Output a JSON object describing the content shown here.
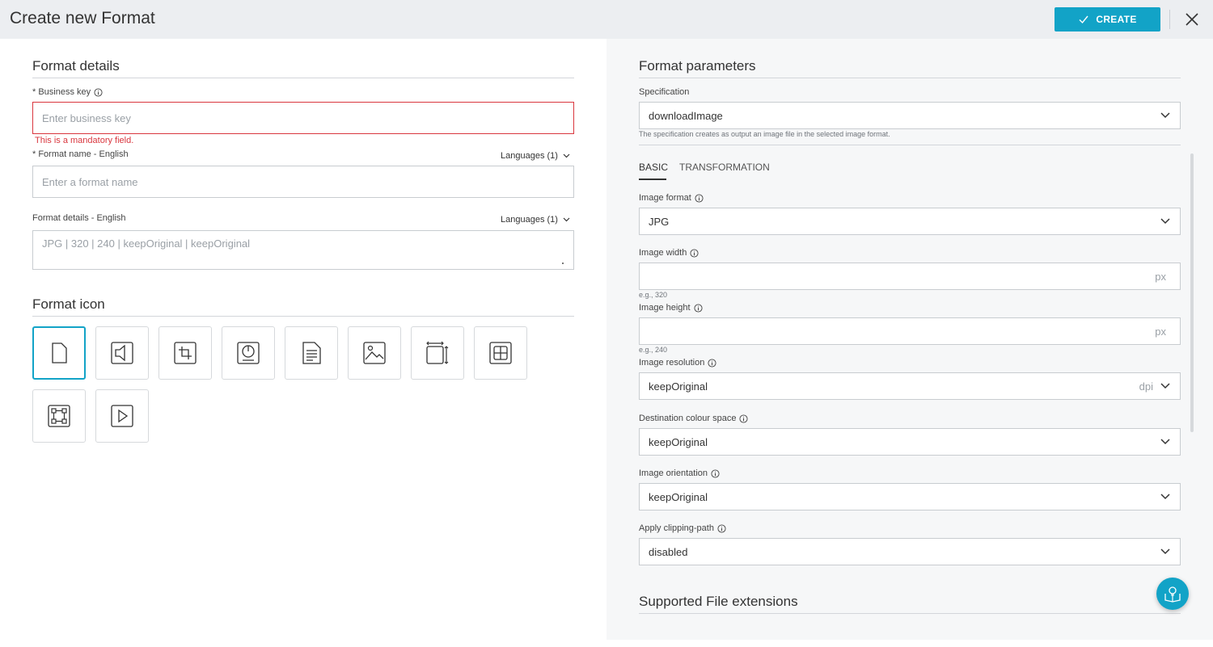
{
  "header": {
    "title": "Create new Format",
    "create_label": "CREATE"
  },
  "format_details": {
    "title": "Format details",
    "business_key": {
      "label": "* Business key",
      "placeholder": "Enter business key",
      "error": "This is a mandatory field."
    },
    "format_name": {
      "label": "* Format name - English",
      "languages": "Languages (1)",
      "placeholder": "Enter a format name"
    },
    "details": {
      "label": "Format details - English",
      "languages": "Languages (1)",
      "placeholder": "JPG | 320 | 240 | keepOriginal | keepOriginal"
    }
  },
  "format_icon": {
    "title": "Format icon",
    "icons": [
      "file-icon",
      "audio-icon",
      "crop-icon",
      "disc-icon",
      "document-icon",
      "image-icon",
      "resize-icon",
      "grid-icon",
      "transform-icon",
      "video-icon"
    ],
    "selected": "file-icon"
  },
  "format_parameters": {
    "title": "Format parameters",
    "specification": {
      "label": "Specification",
      "value": "downloadImage",
      "hint": "The specification creates as output an image file in the selected image format."
    },
    "tabs": [
      "BASIC",
      "TRANSFORMATION"
    ],
    "active_tab": "BASIC",
    "fields": {
      "image_format": {
        "label": "Image format",
        "value": "JPG"
      },
      "image_width": {
        "label": "Image width",
        "unit": "px",
        "hint": "e.g., 320"
      },
      "image_height": {
        "label": "Image height",
        "unit": "px",
        "hint": "e.g., 240"
      },
      "image_resolution": {
        "label": "Image resolution",
        "value": "keepOriginal",
        "unit": "dpi"
      },
      "colour_space": {
        "label": "Destination colour space",
        "value": "keepOriginal"
      },
      "orientation": {
        "label": "Image orientation",
        "value": "keepOriginal"
      },
      "clipping_path": {
        "label": "Apply clipping-path",
        "value": "disabled"
      }
    }
  },
  "supported_extensions": {
    "title": "Supported File extensions"
  },
  "colors": {
    "accent": "#12a3c7",
    "error": "#d9363e",
    "header_bg": "#eceef1",
    "panel_bg": "#f6f7f8"
  }
}
